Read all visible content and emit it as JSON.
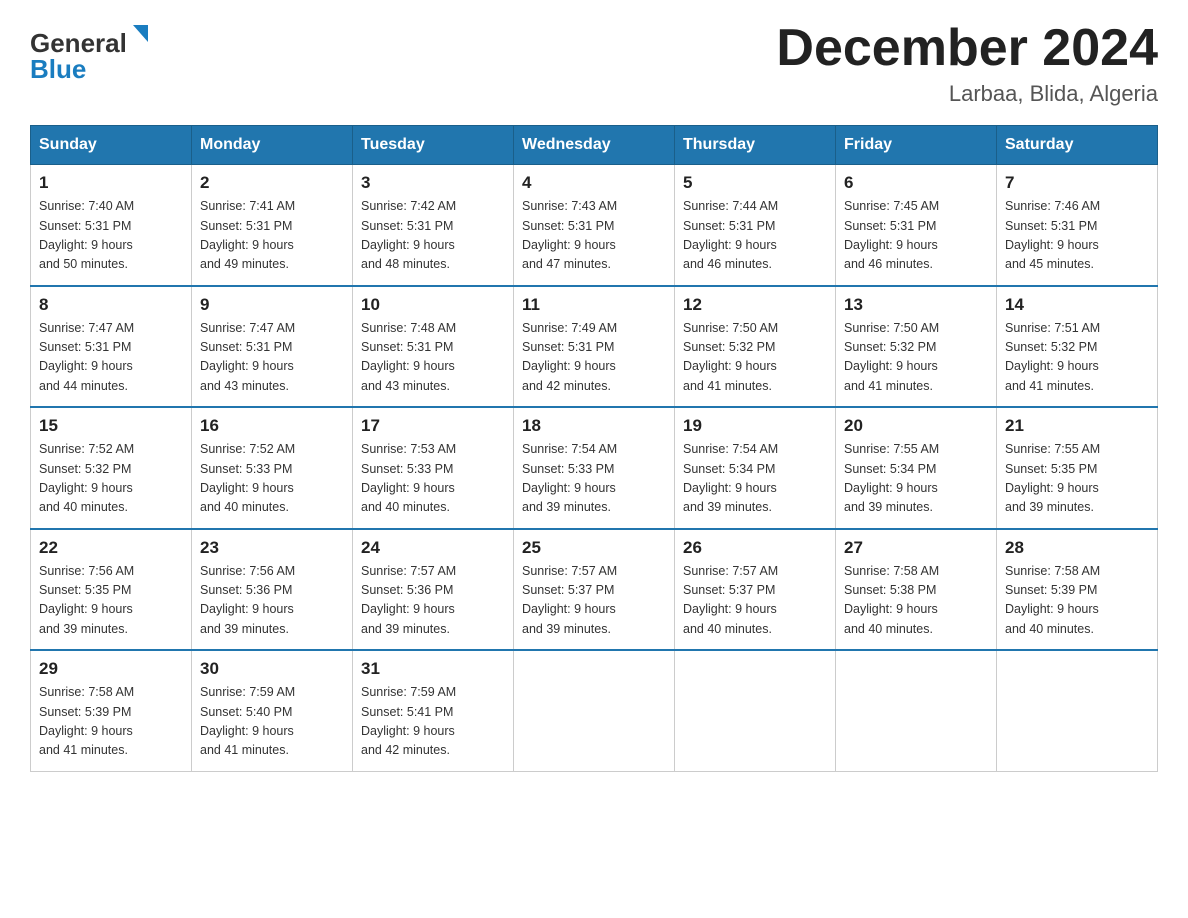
{
  "header": {
    "logo_line1": "General",
    "logo_line2": "Blue",
    "month_title": "December 2024",
    "location": "Larbaa, Blida, Algeria"
  },
  "days_of_week": [
    "Sunday",
    "Monday",
    "Tuesday",
    "Wednesday",
    "Thursday",
    "Friday",
    "Saturday"
  ],
  "weeks": [
    [
      {
        "day": "1",
        "sunrise": "7:40 AM",
        "sunset": "5:31 PM",
        "daylight": "9 hours and 50 minutes."
      },
      {
        "day": "2",
        "sunrise": "7:41 AM",
        "sunset": "5:31 PM",
        "daylight": "9 hours and 49 minutes."
      },
      {
        "day": "3",
        "sunrise": "7:42 AM",
        "sunset": "5:31 PM",
        "daylight": "9 hours and 48 minutes."
      },
      {
        "day": "4",
        "sunrise": "7:43 AM",
        "sunset": "5:31 PM",
        "daylight": "9 hours and 47 minutes."
      },
      {
        "day": "5",
        "sunrise": "7:44 AM",
        "sunset": "5:31 PM",
        "daylight": "9 hours and 46 minutes."
      },
      {
        "day": "6",
        "sunrise": "7:45 AM",
        "sunset": "5:31 PM",
        "daylight": "9 hours and 46 minutes."
      },
      {
        "day": "7",
        "sunrise": "7:46 AM",
        "sunset": "5:31 PM",
        "daylight": "9 hours and 45 minutes."
      }
    ],
    [
      {
        "day": "8",
        "sunrise": "7:47 AM",
        "sunset": "5:31 PM",
        "daylight": "9 hours and 44 minutes."
      },
      {
        "day": "9",
        "sunrise": "7:47 AM",
        "sunset": "5:31 PM",
        "daylight": "9 hours and 43 minutes."
      },
      {
        "day": "10",
        "sunrise": "7:48 AM",
        "sunset": "5:31 PM",
        "daylight": "9 hours and 43 minutes."
      },
      {
        "day": "11",
        "sunrise": "7:49 AM",
        "sunset": "5:31 PM",
        "daylight": "9 hours and 42 minutes."
      },
      {
        "day": "12",
        "sunrise": "7:50 AM",
        "sunset": "5:32 PM",
        "daylight": "9 hours and 41 minutes."
      },
      {
        "day": "13",
        "sunrise": "7:50 AM",
        "sunset": "5:32 PM",
        "daylight": "9 hours and 41 minutes."
      },
      {
        "day": "14",
        "sunrise": "7:51 AM",
        "sunset": "5:32 PM",
        "daylight": "9 hours and 41 minutes."
      }
    ],
    [
      {
        "day": "15",
        "sunrise": "7:52 AM",
        "sunset": "5:32 PM",
        "daylight": "9 hours and 40 minutes."
      },
      {
        "day": "16",
        "sunrise": "7:52 AM",
        "sunset": "5:33 PM",
        "daylight": "9 hours and 40 minutes."
      },
      {
        "day": "17",
        "sunrise": "7:53 AM",
        "sunset": "5:33 PM",
        "daylight": "9 hours and 40 minutes."
      },
      {
        "day": "18",
        "sunrise": "7:54 AM",
        "sunset": "5:33 PM",
        "daylight": "9 hours and 39 minutes."
      },
      {
        "day": "19",
        "sunrise": "7:54 AM",
        "sunset": "5:34 PM",
        "daylight": "9 hours and 39 minutes."
      },
      {
        "day": "20",
        "sunrise": "7:55 AM",
        "sunset": "5:34 PM",
        "daylight": "9 hours and 39 minutes."
      },
      {
        "day": "21",
        "sunrise": "7:55 AM",
        "sunset": "5:35 PM",
        "daylight": "9 hours and 39 minutes."
      }
    ],
    [
      {
        "day": "22",
        "sunrise": "7:56 AM",
        "sunset": "5:35 PM",
        "daylight": "9 hours and 39 minutes."
      },
      {
        "day": "23",
        "sunrise": "7:56 AM",
        "sunset": "5:36 PM",
        "daylight": "9 hours and 39 minutes."
      },
      {
        "day": "24",
        "sunrise": "7:57 AM",
        "sunset": "5:36 PM",
        "daylight": "9 hours and 39 minutes."
      },
      {
        "day": "25",
        "sunrise": "7:57 AM",
        "sunset": "5:37 PM",
        "daylight": "9 hours and 39 minutes."
      },
      {
        "day": "26",
        "sunrise": "7:57 AM",
        "sunset": "5:37 PM",
        "daylight": "9 hours and 40 minutes."
      },
      {
        "day": "27",
        "sunrise": "7:58 AM",
        "sunset": "5:38 PM",
        "daylight": "9 hours and 40 minutes."
      },
      {
        "day": "28",
        "sunrise": "7:58 AM",
        "sunset": "5:39 PM",
        "daylight": "9 hours and 40 minutes."
      }
    ],
    [
      {
        "day": "29",
        "sunrise": "7:58 AM",
        "sunset": "5:39 PM",
        "daylight": "9 hours and 41 minutes."
      },
      {
        "day": "30",
        "sunrise": "7:59 AM",
        "sunset": "5:40 PM",
        "daylight": "9 hours and 41 minutes."
      },
      {
        "day": "31",
        "sunrise": "7:59 AM",
        "sunset": "5:41 PM",
        "daylight": "9 hours and 42 minutes."
      },
      null,
      null,
      null,
      null
    ]
  ],
  "labels": {
    "sunrise_prefix": "Sunrise: ",
    "sunset_prefix": "Sunset: ",
    "daylight_prefix": "Daylight: "
  }
}
